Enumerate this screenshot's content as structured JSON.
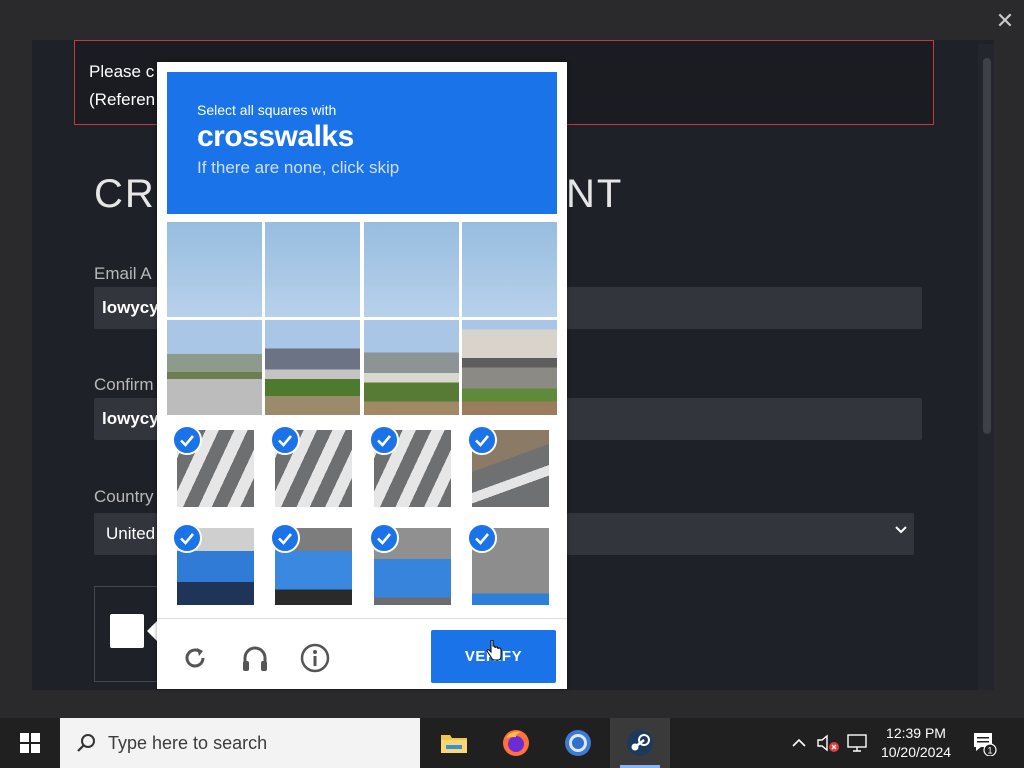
{
  "window": {
    "close_label": "✕"
  },
  "steam": {
    "error_line1": "Please c",
    "error_line2": "(Referen",
    "title_left": "CR",
    "title_right": "NT",
    "email_label": "Email A",
    "email_value": "lowycy",
    "confirm_label": "Confirm",
    "confirm_value": "lowycy",
    "country_label": "Country",
    "country_value": "United"
  },
  "captcha": {
    "instruction": "Select all squares with",
    "target": "crosswalks",
    "hint": "If there are none, click skip",
    "tiles": [
      {
        "scene": "sky",
        "selected": false
      },
      {
        "scene": "sky",
        "selected": false
      },
      {
        "scene": "sky",
        "selected": false
      },
      {
        "scene": "sky",
        "selected": false
      },
      {
        "scene": "houses-a",
        "selected": false
      },
      {
        "scene": "houses-b",
        "selected": false
      },
      {
        "scene": "houses-c",
        "selected": false
      },
      {
        "scene": "houses-d",
        "selected": false
      },
      {
        "scene": "road-stripes",
        "selected": true
      },
      {
        "scene": "road-stripes",
        "selected": true
      },
      {
        "scene": "road-stripes",
        "selected": true
      },
      {
        "scene": "road-dirt",
        "selected": true
      },
      {
        "scene": "car-a",
        "selected": true
      },
      {
        "scene": "car-b",
        "selected": true
      },
      {
        "scene": "car-c",
        "selected": true
      },
      {
        "scene": "car-d",
        "selected": true
      }
    ],
    "verify_label": "VERIFY",
    "icons": [
      "reload-icon",
      "headphones-icon",
      "info-icon"
    ]
  },
  "taskbar": {
    "search_placeholder": "Type here to search",
    "time": "12:39 PM",
    "date": "10/20/2024",
    "notification_count": "1"
  },
  "colors": {
    "captcha_blue": "#1a73e8",
    "steam_bg": "#1e2127",
    "error_border": "#c43a3a"
  }
}
